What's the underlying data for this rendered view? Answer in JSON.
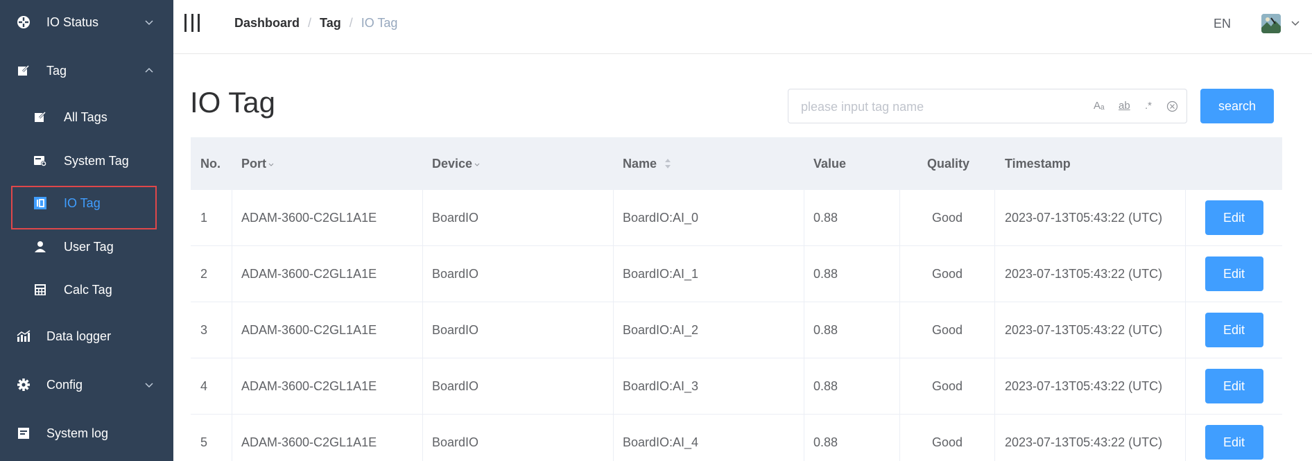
{
  "sidebar": {
    "menu": [
      {
        "label": "IO Status",
        "icon": "dashboard-icon",
        "arrow": "down"
      },
      {
        "label": "Tag",
        "icon": "edit-icon",
        "arrow": "up"
      },
      {
        "label": "Data logger",
        "icon": "chart-icon"
      },
      {
        "label": "Config",
        "icon": "gear-icon",
        "arrow": "down"
      },
      {
        "label": "System log",
        "icon": "log-icon"
      }
    ],
    "submenu": [
      {
        "label": "All Tags",
        "icon": "edit-icon"
      },
      {
        "label": "System Tag",
        "icon": "system-tag-icon"
      },
      {
        "label": "IO Tag",
        "icon": "io-icon",
        "active": true
      },
      {
        "label": "User Tag",
        "icon": "user-icon"
      },
      {
        "label": "Calc Tag",
        "icon": "calculator-icon"
      }
    ]
  },
  "header": {
    "breadcrumb": [
      "Dashboard",
      "Tag",
      "IO Tag"
    ],
    "separator": "/",
    "lang": "EN"
  },
  "main": {
    "title": "IO Tag",
    "search": {
      "placeholder": "please input tag name",
      "opt_case": "Aₐ",
      "opt_word": "ab",
      "opt_regex": ".*",
      "button": "search"
    }
  },
  "table": {
    "columns": [
      "No.",
      "Port",
      "Device",
      "Name",
      "Value",
      "Quality",
      "Timestamp"
    ],
    "edit_label": "Edit",
    "rows": [
      {
        "no": "1",
        "port": "ADAM-3600-C2GL1A1E",
        "device": "BoardIO",
        "name": "BoardIO:AI_0",
        "value": "0.88",
        "quality": "Good",
        "timestamp": "2023-07-13T05:43:22 (UTC)"
      },
      {
        "no": "2",
        "port": "ADAM-3600-C2GL1A1E",
        "device": "BoardIO",
        "name": "BoardIO:AI_1",
        "value": "0.88",
        "quality": "Good",
        "timestamp": "2023-07-13T05:43:22 (UTC)"
      },
      {
        "no": "3",
        "port": "ADAM-3600-C2GL1A1E",
        "device": "BoardIO",
        "name": "BoardIO:AI_2",
        "value": "0.88",
        "quality": "Good",
        "timestamp": "2023-07-13T05:43:22 (UTC)"
      },
      {
        "no": "4",
        "port": "ADAM-3600-C2GL1A1E",
        "device": "BoardIO",
        "name": "BoardIO:AI_3",
        "value": "0.88",
        "quality": "Good",
        "timestamp": "2023-07-13T05:43:22 (UTC)"
      },
      {
        "no": "5",
        "port": "ADAM-3600-C2GL1A1E",
        "device": "BoardIO",
        "name": "BoardIO:AI_4",
        "value": "0.88",
        "quality": "Good",
        "timestamp": "2023-07-13T05:43:22 (UTC)"
      }
    ]
  },
  "colors": {
    "sidebar_bg": "#304156",
    "accent": "#409eff",
    "highlight_box": "#e0474a",
    "table_header_bg": "#eef1f6"
  }
}
